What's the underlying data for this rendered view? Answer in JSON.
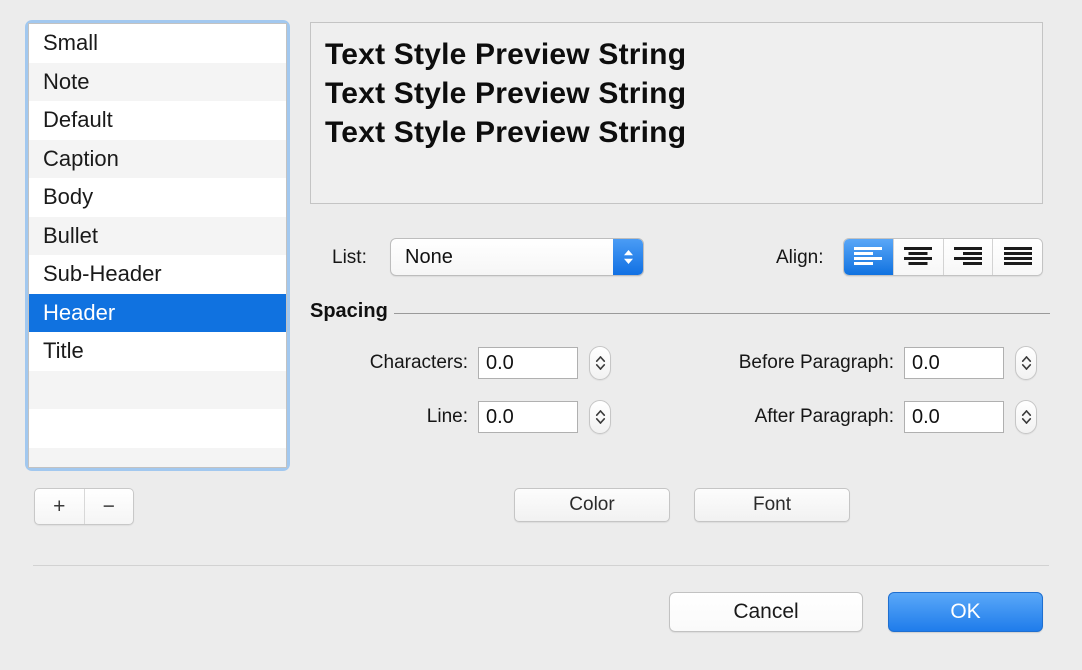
{
  "style_list": {
    "items": [
      {
        "label": "Small",
        "selected": false
      },
      {
        "label": "Note",
        "selected": false
      },
      {
        "label": "Default",
        "selected": false
      },
      {
        "label": "Caption",
        "selected": false
      },
      {
        "label": "Body",
        "selected": false
      },
      {
        "label": "Bullet",
        "selected": false
      },
      {
        "label": "Sub-Header",
        "selected": false
      },
      {
        "label": "Header",
        "selected": true
      },
      {
        "label": "Title",
        "selected": false
      }
    ],
    "empty_rows": 3,
    "add_label": "+",
    "remove_label": "−",
    "selection_color": "#1072e0",
    "focus_ring_color": "#a2c8ef"
  },
  "preview": {
    "lines": [
      "Text Style Preview String",
      "Text Style Preview String",
      "Text Style Preview String"
    ]
  },
  "list_control": {
    "label": "List:",
    "value": "None",
    "options": [
      "None"
    ],
    "arrows_icon": "chevron-up-down-icon",
    "accent_color": "#1170e3"
  },
  "align_control": {
    "label": "Align:",
    "options": [
      {
        "name": "align-left",
        "selected": true
      },
      {
        "name": "align-center",
        "selected": false
      },
      {
        "name": "align-right",
        "selected": false
      },
      {
        "name": "align-justify",
        "selected": false
      }
    ],
    "selected_color": "#1072e0"
  },
  "spacing": {
    "title": "Spacing",
    "fields": [
      {
        "label": "Characters:",
        "value": "0.0"
      },
      {
        "label": "Line:",
        "value": "0.0"
      },
      {
        "label": "Before Paragraph:",
        "value": "0.0"
      },
      {
        "label": "After Paragraph:",
        "value": "0.0"
      }
    ]
  },
  "buttons": {
    "color": "Color",
    "font": "Font",
    "cancel": "Cancel",
    "ok": "OK",
    "ok_color": "#1f7ceb"
  }
}
